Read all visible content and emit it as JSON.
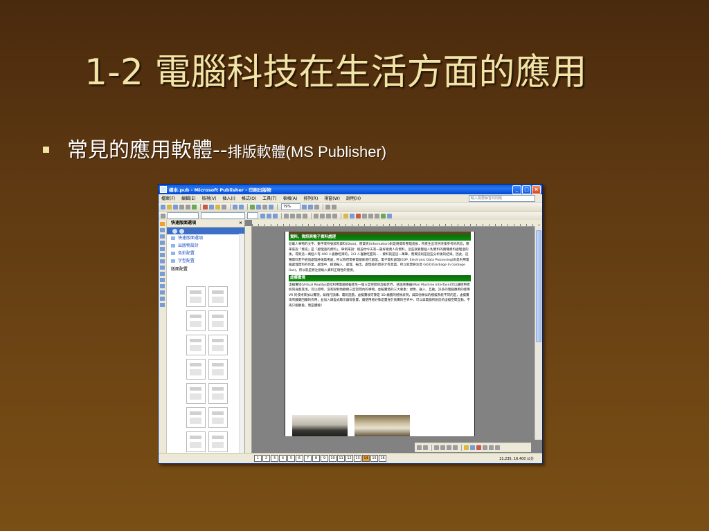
{
  "slide": {
    "title": "1-2 電腦科技在生活方面的應用",
    "bullet_main": "常見的應用軟體--",
    "bullet_sub": "排版軟體",
    "bullet_latin": "(MS Publisher)"
  },
  "window": {
    "title": "樣本.pub - Microsoft Publisher - 印刷出版物",
    "controls": [
      "_",
      "□",
      "×"
    ],
    "menu": [
      "檔案(F)",
      "編輯(E)",
      "檢視(V)",
      "插入(I)",
      "格式(O)",
      "工具(T)",
      "表格(A)",
      "排列(R)",
      "視窗(W)",
      "說明(H)"
    ],
    "help_placeholder": "輸入需要解答的問題",
    "zoom": "79%"
  },
  "task_pane": {
    "title": "快速版面選項",
    "close": "×",
    "items": [
      "快速版面選項",
      "出版物設計",
      "色彩配置",
      "字型配置"
    ],
    "group_label": "版面配置"
  },
  "document": {
    "section1_heading": "資料、資訊與電子資料處理",
    "section1_text": "記載人事物的文字、數字或符號即為資料(Data)，而資訊(Information)則是將資料整理過後，所產生出可供決策參考的訊息，簡單來說「資訊」是「處理過的資料」。舉例來說：假設你今天有一篇好幾萬人的資料，這些就要整個人對資料的兩種資料處理過的後，得到這一萬個人有 400 人喜歡吃辣的，2/3 人喜歡吃甜的……資料就是這一萬筆，而資訊則是這些分析後的結果。因此，這種資料若不經過處理將毫無用處，所以我們需要電腦來進行處理。電子資料處理(EDP, Electronic Data Processing)則是利用電腦處理資料的作業，處理中，經過輸入、處理、輸出，處理後的資訊才有意義。所以就需要注意 GIGO(Garbage In Garbage Out)，所以就是要注意輸入資料正確性的重要。",
    "section2_heading": "虛擬實境",
    "section2_text": "虛擬實境(Virtual Reality)是指利用電腦模擬產生一個三度空間的虛擬世界，透過感應器(Man Machine Interface)可以讓使用者如同身歷其境，可以即時、沒有限制地觀察三度空間內的事物。虛擬實境的三大要素：想像、融入、互動。許多的電腦應用的使用 VR 的技術來加以實現，如飛行訓練、電玩遊戲。虛擬實境可算是 3D 繪圖的極致表現，與其他類似的模擬系統不同的是，虛擬實境有觸覺回饋的作用，並加入頭盔式顯示器等裝置，讓使用者好像是置身於真實的世界中，可以與電腦所創造的虛擬空間互動，不再只能觀看，而是體驗！"
  },
  "status": {
    "pages": [
      "1",
      "2",
      "3",
      "4",
      "5",
      "6",
      "7",
      "8",
      "9",
      "10",
      "11",
      "12",
      "13",
      "14",
      "15",
      "16"
    ],
    "current_page": "14",
    "coords": "21.235, 16.400 公分"
  }
}
